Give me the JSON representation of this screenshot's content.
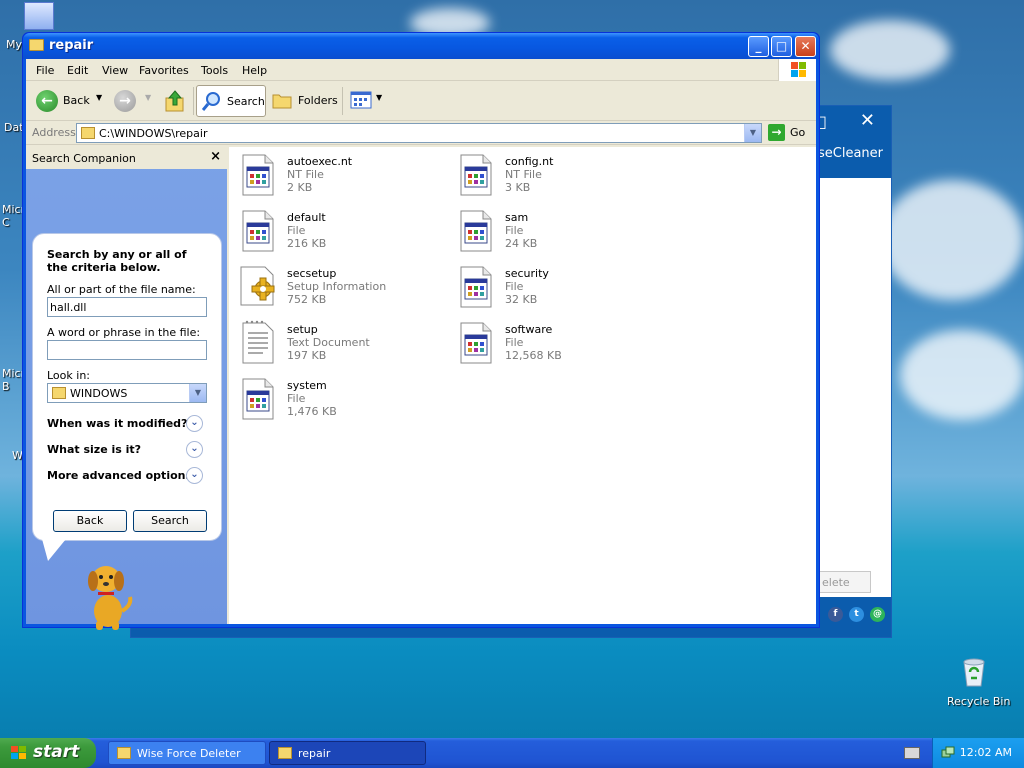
{
  "desktop": {
    "icons": [
      {
        "label": "My"
      },
      {
        "label": "Dat"
      },
      {
        "label": "Micro C"
      },
      {
        "label": "Micro B"
      },
      {
        "label": "W"
      }
    ],
    "recycle_bin": "Recycle Bin"
  },
  "background_window": {
    "title": "iseCleaner",
    "button": "elete"
  },
  "window": {
    "title": "repair",
    "menu": [
      "File",
      "Edit",
      "View",
      "Favorites",
      "Tools",
      "Help"
    ],
    "toolbar": {
      "back": "Back",
      "search": "Search",
      "folders": "Folders"
    },
    "address": {
      "label": "Address",
      "path": "C:\\WINDOWS\\repair",
      "go": "Go"
    }
  },
  "search_companion": {
    "title": "Search Companion",
    "intro": "Search by any or all of the criteria below.",
    "filename_label": "All or part of the file name:",
    "filename_value": "hall.dll",
    "phrase_label": "A word or phrase in the file:",
    "phrase_value": "",
    "lookin_label": "Look in:",
    "lookin_value": "WINDOWS",
    "options": [
      "When was it modified?",
      "What size is it?",
      "More advanced options"
    ],
    "back_button": "Back",
    "search_button": "Search"
  },
  "files": [
    {
      "name": "autoexec.nt",
      "type": "NT File",
      "size": "2 KB"
    },
    {
      "name": "config.nt",
      "type": "NT File",
      "size": "3 KB"
    },
    {
      "name": "default",
      "type": "File",
      "size": "216 KB"
    },
    {
      "name": "sam",
      "type": "File",
      "size": "24 KB"
    },
    {
      "name": "secsetup",
      "type": "Setup Information",
      "size": "752 KB"
    },
    {
      "name": "security",
      "type": "File",
      "size": "32 KB"
    },
    {
      "name": "setup",
      "type": "Text Document",
      "size": "197 KB"
    },
    {
      "name": "software",
      "type": "File",
      "size": "12,568 KB"
    },
    {
      "name": "system",
      "type": "File",
      "size": "1,476 KB"
    }
  ],
  "taskbar": {
    "start": "start",
    "tasks": [
      "Wise Force Deleter",
      "repair"
    ],
    "clock": "12:02 AM"
  }
}
